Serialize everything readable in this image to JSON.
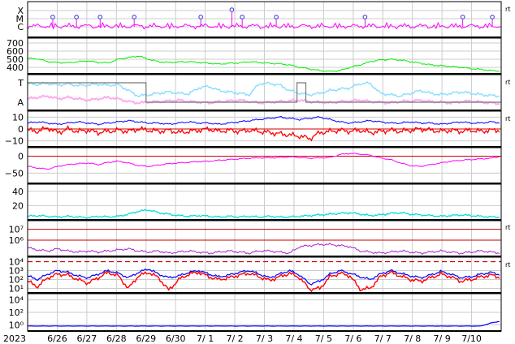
{
  "chart_data": {
    "type": "line",
    "x_axis": {
      "year_label": "2023",
      "ticks": [
        "6/26",
        "6/27",
        "6/28",
        "6/29",
        "6/30",
        "7/ 1",
        "7/ 2",
        "7/ 3",
        "7/ 4",
        "7/ 5",
        "7/ 6",
        "7/ 7",
        "7/ 8",
        "7/ 9",
        "7/10"
      ],
      "range": [
        "2023-06-25",
        "2023-07-11"
      ]
    },
    "grid": true,
    "side_marker": "rt",
    "colors": {
      "xmc": "#ff00ff",
      "speed": "#00ee00",
      "temp": "#88ddff",
      "angle": "#ffaaee",
      "bt": "#0000ff",
      "bz": "#ff0000",
      "dst": "#ff00ff",
      "density": "#00dddd",
      "proton": "#aa22cc",
      "xray": "#0000ff",
      "electron": "#ff0000",
      "threshold": "#cc0000",
      "bottom": "#0000ff"
    },
    "panels": [
      {
        "name": "xray-flare",
        "y_tick_labels": [
          "X",
          "M",
          "C"
        ],
        "flare_markers": [
          {
            "day": 0.85,
            "class": "M"
          },
          {
            "day": 1.65,
            "class": "M"
          },
          {
            "day": 2.45,
            "class": "M"
          },
          {
            "day": 3.6,
            "class": "M"
          },
          {
            "day": 5.85,
            "class": "M"
          },
          {
            "day": 6.9,
            "class": "X"
          },
          {
            "day": 7.25,
            "class": "M"
          },
          {
            "day": 8.4,
            "class": "M"
          },
          {
            "day": 11.4,
            "class": "M"
          },
          {
            "day": 14.7,
            "class": "M"
          },
          {
            "day": 15.7,
            "class": "M"
          }
        ]
      },
      {
        "name": "solar-wind-speed",
        "y_tick_labels": [
          "700",
          "600",
          "500",
          "400"
        ],
        "ylim": [
          320,
          760
        ],
        "values_km_s": [
          510,
          505,
          470,
          460,
          455,
          470,
          480,
          460,
          455,
          500,
          520,
          540,
          500,
          470,
          460,
          465,
          470,
          460,
          450,
          440,
          450,
          455,
          470,
          460,
          450,
          445,
          430,
          400,
          380,
          360,
          350,
          360,
          400,
          430,
          470,
          490,
          500,
          490,
          470,
          450,
          430,
          420,
          410,
          400,
          385,
          375,
          360,
          355
        ]
      },
      {
        "name": "temperature-angle",
        "y_tick_labels": [
          "T",
          "A"
        ],
        "temperature_series": [
          0.85,
          0.82,
          0.86,
          0.8,
          0.84,
          0.78,
          0.8,
          0.83,
          0.79,
          0.81,
          0.6,
          0.4,
          0.45,
          0.5,
          0.55,
          0.5,
          0.48,
          0.7,
          0.75,
          0.6,
          0.55,
          0.5,
          0.45,
          0.85,
          0.86,
          0.8,
          0.6,
          0.5,
          0.45,
          0.5,
          0.6,
          0.65,
          0.7,
          0.85,
          0.86,
          0.5,
          0.45,
          0.4,
          0.5,
          0.6,
          0.5,
          0.45,
          0.5,
          0.55,
          0.5,
          0.45,
          0.42,
          0.4
        ],
        "angle_series": [
          0.3,
          0.35,
          0.4,
          0.3,
          0.35,
          0.3,
          0.25,
          0.3,
          0.35,
          0.3,
          0.2,
          0.15,
          0.18,
          0.2,
          0.22,
          0.25,
          0.2,
          0.18,
          0.15,
          0.2,
          0.22,
          0.25,
          0.2,
          0.15,
          0.18,
          0.2,
          0.22,
          0.25,
          0.2,
          0.18,
          0.15,
          0.2,
          0.22,
          0.25,
          0.2,
          0.18,
          0.15,
          0.2,
          0.22,
          0.25,
          0.2,
          0.18,
          0.15,
          0.2,
          0.22,
          0.18,
          0.15,
          0.12
        ],
        "sector_steps": [
          {
            "from": 0,
            "to": 4.0,
            "level": "T"
          },
          {
            "from": 4.0,
            "to": 9.1,
            "level": "A"
          },
          {
            "from": 9.1,
            "to": 9.4,
            "level": "T"
          },
          {
            "from": 9.4,
            "to": 16,
            "level": "A"
          }
        ]
      },
      {
        "name": "imf-bt-bz",
        "y_tick_labels": [
          "10",
          "0",
          "−10"
        ],
        "ylim": [
          -15,
          15
        ],
        "bt": [
          5,
          6,
          5,
          4,
          5,
          6,
          5,
          4,
          5,
          6,
          7,
          6,
          5,
          5,
          4,
          5,
          6,
          5,
          5,
          4,
          5,
          6,
          7,
          8,
          9,
          10,
          9,
          8,
          9,
          10,
          8,
          6,
          5,
          6,
          7,
          6,
          5,
          5,
          6,
          5,
          5,
          4,
          5,
          6,
          5,
          5,
          6,
          5
        ],
        "bz": [
          -1,
          -2,
          1,
          -3,
          0,
          -2,
          -1,
          -3,
          -2,
          -1,
          -2,
          0,
          -1,
          -2,
          -1,
          -3,
          -2,
          -1,
          0,
          -2,
          -1,
          -2,
          -1,
          -2,
          -3,
          -4,
          -5,
          -6,
          -8,
          -3,
          -2,
          -1,
          -2,
          -1,
          -3,
          -2,
          -1,
          -2,
          -1,
          0,
          -1,
          -2,
          -1,
          -2,
          -1,
          -2,
          -1,
          -1
        ]
      },
      {
        "name": "dst-index",
        "y_tick_labels": [
          "0",
          "−50"
        ],
        "ylim": [
          -80,
          25
        ],
        "values_nT": [
          -30,
          -35,
          -38,
          -30,
          -25,
          -22,
          -20,
          -25,
          -18,
          -15,
          -20,
          -28,
          -30,
          -26,
          -22,
          -20,
          -18,
          -16,
          -15,
          -12,
          -10,
          -8,
          -6,
          -5,
          -5,
          -4,
          -2,
          -4,
          -6,
          -5,
          -4,
          5,
          8,
          6,
          3,
          -5,
          -10,
          -20,
          -28,
          -30,
          -25,
          -20,
          -15,
          -12,
          -10,
          -8,
          -6,
          0
        ]
      },
      {
        "name": "solar-wind-density",
        "y_tick_labels": [
          "40",
          "20"
        ],
        "ylim": [
          0,
          50
        ],
        "values_per_cc": [
          5,
          6,
          5,
          4,
          5,
          4,
          3,
          5,
          4,
          5,
          8,
          12,
          14,
          10,
          8,
          6,
          5,
          6,
          5,
          4,
          5,
          4,
          5,
          4,
          5,
          4,
          4,
          5,
          6,
          7,
          8,
          9,
          10,
          8,
          6,
          7,
          9,
          10,
          8,
          7,
          6,
          5,
          6,
          7,
          6,
          5,
          4,
          4
        ]
      },
      {
        "name": "proton-flux",
        "y_tick_labels": [
          "10⁷",
          "10⁶"
        ],
        "threshold_lines": [
          10000000,
          1000000
        ],
        "log_range": [
          4.5,
          7.8
        ],
        "values": [
          5.3,
          5.1,
          5.0,
          5.2,
          5.0,
          4.9,
          5.0,
          4.9,
          5.0,
          5.1,
          5.2,
          5.0,
          4.9,
          5.0,
          4.8,
          4.9,
          5.0,
          4.9,
          4.8,
          4.9,
          5.0,
          4.9,
          4.8,
          5.0,
          5.0,
          4.9,
          4.8,
          5.4,
          5.5,
          5.6,
          5.6,
          5.5,
          5.4,
          5.0,
          4.9,
          4.8,
          4.9,
          5.0,
          4.9,
          4.8,
          4.9,
          5.0,
          4.9,
          4.8,
          4.9,
          5.0,
          4.9,
          4.8
        ]
      },
      {
        "name": "electron-flux",
        "y_tick_labels": [
          "10⁴",
          "10³",
          "10²",
          "10¹"
        ],
        "threshold": 10000,
        "log_range": [
          0.5,
          4.5
        ],
        "blue": [
          2.4,
          2.0,
          2.6,
          3.0,
          2.8,
          2.4,
          2.2,
          2.6,
          3.0,
          2.7,
          2.2,
          2.8,
          3.2,
          2.6,
          2.2,
          2.4,
          2.8,
          3.0,
          2.6,
          2.3,
          2.5,
          2.8,
          3.0,
          2.6,
          2.2,
          2.6,
          3.0,
          2.5,
          1.5,
          1.8,
          2.6,
          3.0,
          2.7,
          2.3,
          2.0,
          2.6,
          3.0,
          2.7,
          2.4,
          2.2,
          2.5,
          2.9,
          2.6,
          2.2,
          2.3,
          2.6,
          2.8,
          2.5
        ],
        "red": [
          1.8,
          1.2,
          2.2,
          2.6,
          2.5,
          2.0,
          1.6,
          2.2,
          2.8,
          2.4,
          1.0,
          2.4,
          2.8,
          2.2,
          0.8,
          2.0,
          2.6,
          2.8,
          2.3,
          2.0,
          2.2,
          2.5,
          2.7,
          2.3,
          1.9,
          2.3,
          2.7,
          2.2,
          0.9,
          1.0,
          2.3,
          2.7,
          2.4,
          0.9,
          1.0,
          2.3,
          2.8,
          2.4,
          2.0,
          1.8,
          2.2,
          2.6,
          2.3,
          1.8,
          2.0,
          2.3,
          2.5,
          2.2
        ]
      },
      {
        "name": "bottom-panel",
        "y_tick_labels": [
          "10⁴",
          "10²",
          "10⁰"
        ],
        "log_range": [
          -1,
          5
        ],
        "values": [
          -0.2,
          -0.2,
          -0.2,
          -0.2,
          -0.2,
          -0.2,
          -0.2,
          -0.2,
          -0.2,
          -0.2,
          -0.2,
          -0.2,
          -0.2,
          -0.2,
          -0.2,
          -0.2,
          -0.2,
          -0.2,
          -0.2,
          -0.2,
          -0.2,
          -0.2,
          -0.2,
          -0.2,
          -0.2,
          -0.2,
          -0.2,
          -0.2,
          -0.2,
          -0.2,
          -0.2,
          -0.2,
          -0.2,
          -0.2,
          -0.2,
          -0.2,
          -0.2,
          -0.2,
          -0.2,
          -0.2,
          -0.2,
          -0.2,
          -0.2,
          -0.2,
          -0.2,
          -0.2,
          0.3,
          0.6
        ]
      }
    ]
  }
}
